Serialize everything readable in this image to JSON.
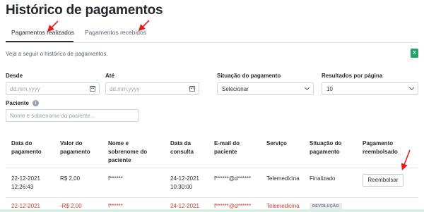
{
  "page_title": "Histórico de pagamentos",
  "tabs": [
    {
      "label": "Pagamentos realizados",
      "active": true
    },
    {
      "label": "Pagamentos recebidos",
      "active": false
    }
  ],
  "intro_text": "Veja a seguir o histórico de pagamentos.",
  "filters": {
    "desde": {
      "label": "Desde",
      "placeholder": "dd.mm.yyyy"
    },
    "ate": {
      "label": "Até",
      "placeholder": "dd.mm.yyyy"
    },
    "situacao": {
      "label": "Situação do pagamento",
      "value": "Selecionar"
    },
    "resultados": {
      "label": "Resultados por página",
      "value": "10"
    },
    "paciente": {
      "label": "Paciente",
      "placeholder": "Nome e sobrenome do paciente..."
    }
  },
  "table": {
    "headers": [
      "Data do\npagamento",
      "Valor do\npagamento",
      "Nome e\nsobrenome do\npaciente",
      "Data da\nconsulta",
      "E-mail do\npaciente",
      "Serviço",
      "Situação do\npagamento",
      "Pagamento\nreembolsado"
    ],
    "rows": [
      {
        "data_pagamento": "22-12-2021\n12:26:43",
        "valor": "R$ 2,00",
        "nome": "f******",
        "data_consulta": "24-12-2021\n10:30:00",
        "email": "f******@d******",
        "servico": "Telemedicina",
        "situacao": "Finalizado",
        "action_label": "Reembolsar"
      },
      {
        "data_pagamento": "22-12-2021",
        "valor": "-R$ 2,00",
        "nome": "f******",
        "data_consulta": "24-12-2021",
        "email": "f******@d******",
        "servico": "Telemedicina",
        "badge": "DEVOLUÇÃO"
      }
    ]
  },
  "colors": {
    "refund_text": "#d9372b",
    "annotation_arrow": "#e0201b",
    "excel_green": "#1fa463"
  },
  "icons": [
    "excel-export-icon",
    "calendar-icon",
    "chevron-down-icon",
    "info-icon"
  ]
}
